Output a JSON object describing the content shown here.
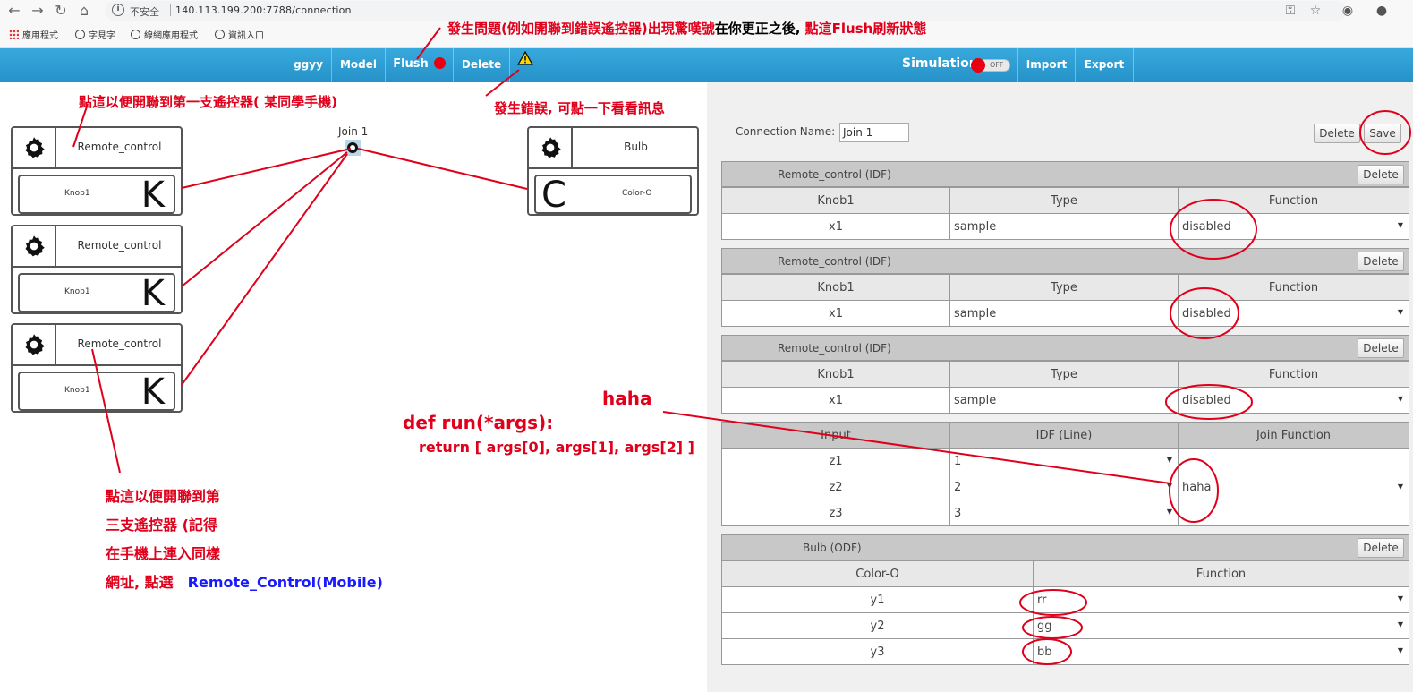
{
  "browser": {
    "security_label": "不安全",
    "url": "140.113.199.200:7788/connection",
    "bookmarks": [
      "應用程式",
      "字見字",
      "線網應用程式",
      "資訊入口"
    ]
  },
  "appbar": {
    "project": "ggyy",
    "model": "Model",
    "flush": "Flush",
    "delete": "Delete",
    "simulation": "Simulation",
    "sim_state": "OFF",
    "import": "Import",
    "export": "Export"
  },
  "canvas": {
    "join_label": "Join 1",
    "devices": [
      {
        "name": "Remote_control",
        "feature": "Knob1",
        "letter": "K"
      },
      {
        "name": "Remote_control",
        "feature": "Knob1",
        "letter": "K"
      },
      {
        "name": "Remote_control",
        "feature": "Knob1",
        "letter": "K"
      },
      {
        "name": "Bulb",
        "feature": "Color-O",
        "letter": "C"
      }
    ]
  },
  "panel": {
    "connection_name_label": "Connection Name:",
    "connection_name_value": "Join 1",
    "delete_label": "Delete",
    "save_label": "Save",
    "idf_sections": [
      {
        "title": "Remote_control (IDF)",
        "headers": [
          "Knob1",
          "Type",
          "Function"
        ],
        "row": [
          "x1",
          "sample",
          "disabled"
        ]
      },
      {
        "title": "Remote_control (IDF)",
        "headers": [
          "Knob1",
          "Type",
          "Function"
        ],
        "row": [
          "x1",
          "sample",
          "disabled"
        ]
      },
      {
        "title": "Remote_control (IDF)",
        "headers": [
          "Knob1",
          "Type",
          "Function"
        ],
        "row": [
          "x1",
          "sample",
          "disabled"
        ]
      }
    ],
    "join": {
      "headers": [
        "Input",
        "IDF (Line)",
        "Join Function"
      ],
      "rows": [
        [
          "z1",
          "1"
        ],
        [
          "z2",
          "2"
        ],
        [
          "z3",
          "3"
        ]
      ],
      "function_value": "haha"
    },
    "odf": {
      "title": "Bulb (ODF)",
      "headers": [
        "Color-O",
        "Function"
      ],
      "rows": [
        [
          "y1",
          "rr"
        ],
        [
          "y2",
          "gg"
        ],
        [
          "y3",
          "bb"
        ]
      ]
    }
  },
  "annotations": {
    "flush_note_1": "發生問題(例如開聯到錯誤遙控器)出現驚嘆號",
    "flush_note_2": "在你更正之後, ",
    "flush_note_3": "點這Flush刷新狀態",
    "first_controller_note": "點這以便開聯到第一支遙控器( 某同學手機)",
    "error_note": "發生錯誤, 可點一下看看訊息",
    "haha_label": "haha",
    "code_line_1": "def run(*args):",
    "code_line_2": "return [ args[0], args[1], args[2] ]",
    "third_note_1": "點這以便開聯到第",
    "third_note_2": "三支遙控器 (記得",
    "third_note_3": "在手機上連入同樣",
    "third_note_4": "網址, 點選",
    "third_note_link": "Remote_Control(Mobile)"
  },
  "colors": {
    "nav_blue": "#2a9fd6",
    "annotation_red": "#e0001b",
    "annotation_blue": "#1a1aff",
    "flush_red": "#e60012"
  }
}
